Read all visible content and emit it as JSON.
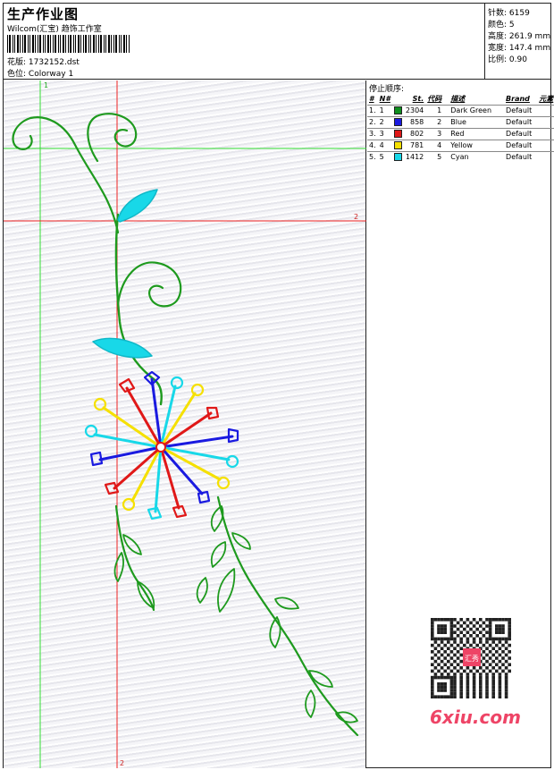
{
  "header": {
    "title": "生产作业图",
    "subtitle": "Wilcom(汇宝) 趋饰工作室",
    "design_file_label": "花版:",
    "design_file": "1732152.dst",
    "colorway_label": "色位:",
    "colorway": "Colorway 1"
  },
  "stats": [
    {
      "label": "针数:",
      "value": "6159"
    },
    {
      "label": "颜色:",
      "value": "5"
    },
    {
      "label": "高度:",
      "value": "261.9 mm"
    },
    {
      "label": "宽度:",
      "value": "147.4 mm"
    },
    {
      "label": "比例:",
      "value": "0.90"
    }
  ],
  "guides": {
    "green_v": "1",
    "red_v_top": "",
    "red_h": "2",
    "red_v_bottom": "2"
  },
  "stop_sequence": {
    "title": "停止顺序:",
    "columns": [
      "#",
      "N#",
      "St.",
      "代码",
      "描述",
      "Brand",
      "元素"
    ],
    "rows": [
      {
        "idx": "1.",
        "n": "1",
        "color": "#0f8f1f",
        "st": "2304",
        "code": "1",
        "desc": "Dark Green",
        "brand": "Default"
      },
      {
        "idx": "2.",
        "n": "2",
        "color": "#1a1ae0",
        "st": "858",
        "code": "2",
        "desc": "Blue",
        "brand": "Default"
      },
      {
        "idx": "3.",
        "n": "3",
        "color": "#e01818",
        "st": "802",
        "code": "3",
        "desc": "Red",
        "brand": "Default"
      },
      {
        "idx": "4.",
        "n": "4",
        "color": "#f5e000",
        "st": "781",
        "code": "4",
        "desc": "Yellow",
        "brand": "Default"
      },
      {
        "idx": "5.",
        "n": "5",
        "color": "#18d8e8",
        "st": "1412",
        "code": "5",
        "desc": "Cyan",
        "brand": "Default"
      }
    ]
  },
  "watermark": {
    "text": "6xiu.com",
    "stamp": "汇秀",
    "color": "#ee4466"
  },
  "thread_colors": {
    "green": "#1e9a1e",
    "blue": "#1a1ae0",
    "red": "#e01818",
    "yellow": "#f5e000",
    "cyan": "#18d8e8"
  }
}
